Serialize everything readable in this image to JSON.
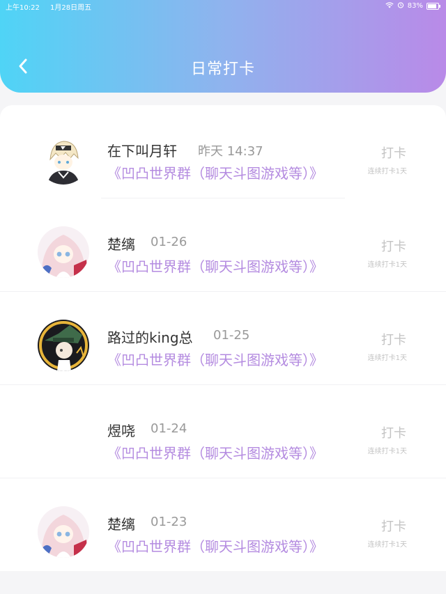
{
  "status": {
    "time": "上午10:22",
    "date": "1月28日周五",
    "battery": "83%"
  },
  "page": {
    "title": "日常打卡"
  },
  "entries": [
    {
      "name": "在下叫月轩",
      "time": "昨天 14:37",
      "group": "《凹凸世界群（聊天斗图游戏等）》",
      "action": "打卡",
      "streak": "连续打卡1天",
      "avatar": "white-hair-boy-avatar"
    },
    {
      "name": "楚缡",
      "time": "01-26",
      "group": "《凹凸世界群（聊天斗图游戏等）》",
      "action": "打卡",
      "streak": "连续打卡1天",
      "avatar": "pink-hair-girl-avatar"
    },
    {
      "name": "路过的king总",
      "time": "01-25",
      "group": "《凹凸世界群（聊天斗图游戏等）》",
      "action": "打卡",
      "streak": "连续打卡1天",
      "avatar": "dark-hat-character-avatar"
    },
    {
      "name": "煜哓",
      "time": "01-24",
      "group": "《凹凸世界群（聊天斗图游戏等）》",
      "action": "打卡",
      "streak": "连续打卡1天",
      "avatar": ""
    },
    {
      "name": "楚缡",
      "time": "01-23",
      "group": "《凹凸世界群（聊天斗图游戏等）》",
      "action": "打卡",
      "streak": "连续打卡1天",
      "avatar": "pink-hair-girl-avatar"
    }
  ],
  "colors": {
    "accent": "#b48be0",
    "header_start": "#4fd4f6",
    "header_end": "#b98ae8"
  }
}
